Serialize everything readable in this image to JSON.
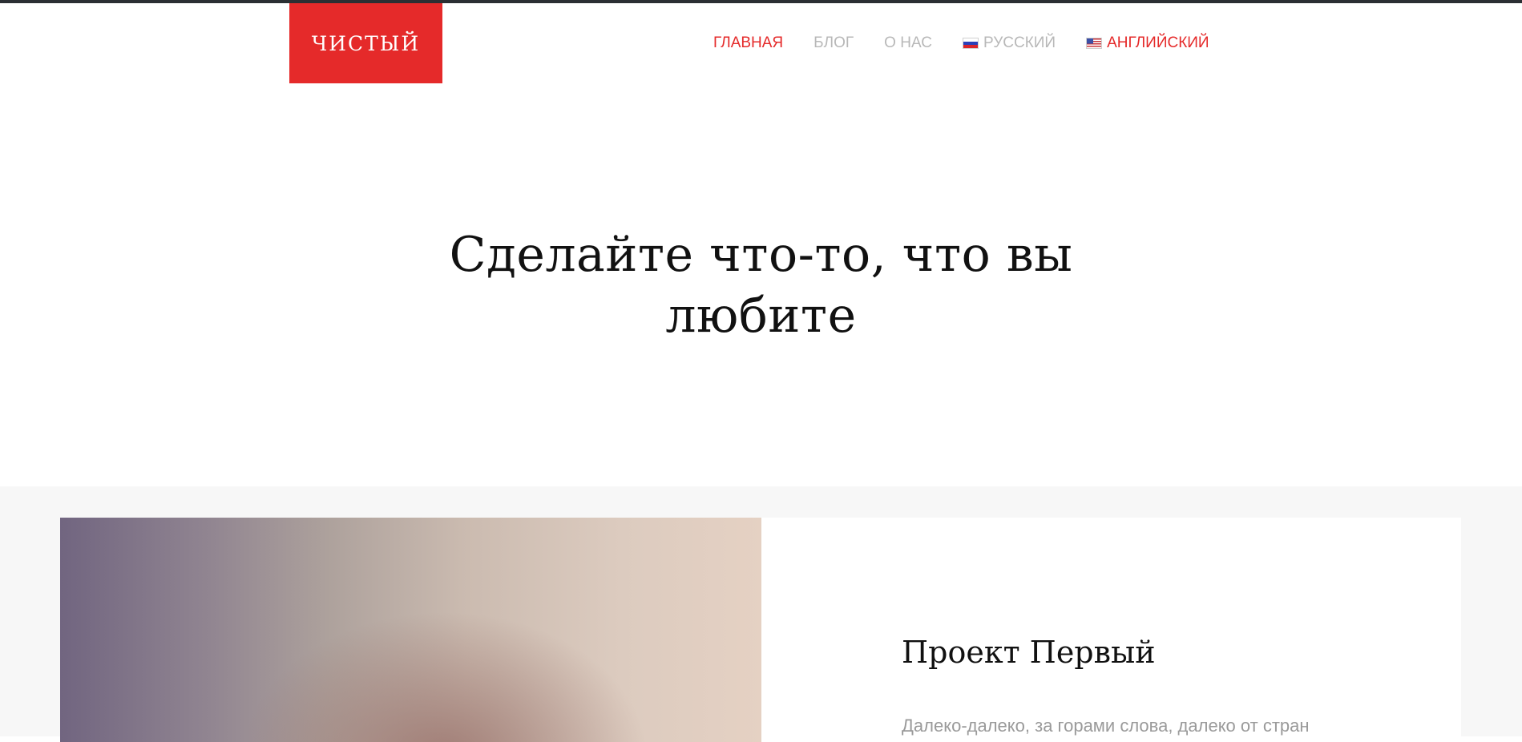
{
  "header": {
    "logo_text": "ЧИСТЫЙ",
    "nav": [
      {
        "label": "ГЛАВНАЯ",
        "active": true
      },
      {
        "label": "БЛОГ",
        "active": false
      },
      {
        "label": "О НАС",
        "active": false
      }
    ],
    "languages": [
      {
        "label": "РУССКИЙ",
        "icon": "flag-ru-icon",
        "active": false
      },
      {
        "label": "АНГЛИЙСКИЙ",
        "icon": "flag-us-icon",
        "active": true
      }
    ]
  },
  "hero": {
    "title": "Сделайте что-то, что вы любите"
  },
  "project": {
    "title": "Проект Первый",
    "description": "Далеко-далеко, за горами слова, далеко от стран"
  },
  "colors": {
    "accent": "#e52a2a",
    "nav_inactive": "#b8b8b8",
    "section_bg": "#f7f7f7"
  }
}
